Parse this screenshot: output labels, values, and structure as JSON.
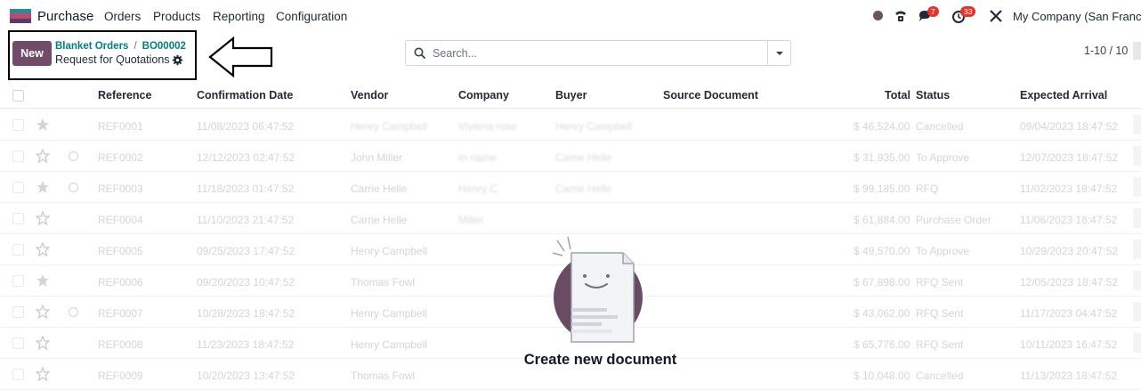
{
  "app": {
    "name": "Purchase",
    "brand_color": "#714b67",
    "accent_color": "#017e84"
  },
  "menu": [
    "Orders",
    "Products",
    "Reporting",
    "Configuration"
  ],
  "systray": {
    "phone_icon": "phone-icon",
    "messages_badge": "7",
    "activity_badge": "33",
    "tools_icon": "tools-icon",
    "company": "My Company (San Francisc"
  },
  "control": {
    "new_label": "New",
    "breadcrumb": [
      "Blanket Orders",
      "BO00002"
    ],
    "breadcrumb_sep": "/",
    "page_title": "Request for Quotations",
    "search_placeholder": "Search...",
    "pager": "1-10 / 10"
  },
  "table": {
    "columns": [
      "Reference",
      "Confirmation Date",
      "Vendor",
      "Company",
      "Buyer",
      "Source Document",
      "Total",
      "Status",
      "Expected Arrival"
    ],
    "rows": [
      {
        "ref": "REF0001",
        "date": "11/08/2023 06:47:52",
        "vendor": "Henry Campbell",
        "company": "Viviena rose",
        "buyer": "Henry Campbell",
        "total": "$ 46,524.00",
        "status": "Cancelled",
        "arrival": "09/04/2023 18:47:52"
      },
      {
        "ref": "REF0002",
        "date": "12/12/2023 02:47:52",
        "vendor": "John Miller",
        "company": "In name",
        "buyer": "Carrie Helle",
        "total": "$ 31,935.00",
        "status": "To Approve",
        "arrival": "12/07/2023 18:47:52"
      },
      {
        "ref": "REF0003",
        "date": "11/18/2023 01:47:52",
        "vendor": "Carrie Helle",
        "company": "Henry C.",
        "buyer": "Carrie Helle",
        "total": "$ 99,185.00",
        "status": "RFQ",
        "arrival": "11/02/2023 18:47:52"
      },
      {
        "ref": "REF0004",
        "date": "11/10/2023 21:47:52",
        "vendor": "Carrie Helle",
        "company": "Miller",
        "buyer": "",
        "total": "$ 61,884.00",
        "status": "Purchase Order",
        "arrival": "11/06/2023 18:47:52"
      },
      {
        "ref": "REF0005",
        "date": "09/25/2023 17:47:52",
        "vendor": "Henry Campbell",
        "company": "",
        "buyer": "",
        "total": "$ 49,570.00",
        "status": "To Approve",
        "arrival": "10/29/2023 20:47:52"
      },
      {
        "ref": "REF0006",
        "date": "09/20/2023 10:47:52",
        "vendor": "Thomas Fowl",
        "company": "",
        "buyer": "",
        "total": "$ 67,898.00",
        "status": "RFQ Sent",
        "arrival": "12/05/2023 18:47:52"
      },
      {
        "ref": "REF0007",
        "date": "10/28/2023 18:47:52",
        "vendor": "Henry Campbell",
        "company": "",
        "buyer": "",
        "total": "$ 43,062.00",
        "status": "RFQ Sent",
        "arrival": "11/17/2023 04:47:52"
      },
      {
        "ref": "REF0008",
        "date": "11/23/2023 18:47:52",
        "vendor": "Henry Campbell",
        "company": "",
        "buyer": "",
        "total": "$ 65,776.00",
        "status": "RFQ Sent",
        "arrival": "10/11/2023 16:47:52"
      },
      {
        "ref": "REF0009",
        "date": "10/20/2023 13:47:52",
        "vendor": "Thomas Fowl",
        "company": "",
        "buyer": "",
        "total": "$ 10,048.00",
        "status": "Cancelled",
        "arrival": "11/13/2023 18:47:52"
      }
    ]
  },
  "empty_state": {
    "title": "Create new document"
  }
}
